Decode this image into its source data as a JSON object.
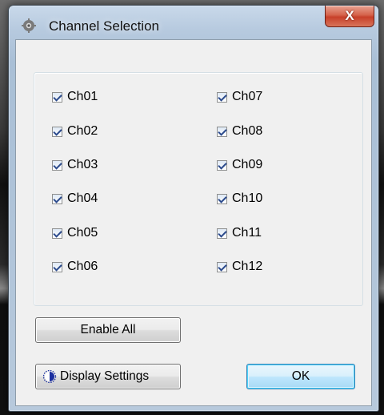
{
  "window": {
    "title": "Channel Selection",
    "close_label": "X"
  },
  "channels": {
    "left": [
      {
        "label": "Ch01",
        "checked": true
      },
      {
        "label": "Ch02",
        "checked": true
      },
      {
        "label": "Ch03",
        "checked": true
      },
      {
        "label": "Ch04",
        "checked": true
      },
      {
        "label": "Ch05",
        "checked": true
      },
      {
        "label": "Ch06",
        "checked": true
      }
    ],
    "right": [
      {
        "label": "Ch07",
        "checked": true
      },
      {
        "label": "Ch08",
        "checked": true
      },
      {
        "label": "Ch09",
        "checked": true
      },
      {
        "label": "Ch10",
        "checked": true
      },
      {
        "label": "Ch11",
        "checked": true
      },
      {
        "label": "Ch12",
        "checked": true
      }
    ]
  },
  "buttons": {
    "enable_all": "Enable All",
    "display_settings": "Display Settings",
    "ok": "OK"
  },
  "icons": {
    "app": "gear-icon",
    "display_settings": "display-settings-icon",
    "close": "close-icon"
  },
  "colors": {
    "ok_accent": "#3c7fb1",
    "close_red": "#c7402a",
    "check_mark": "#2b4a8c"
  }
}
